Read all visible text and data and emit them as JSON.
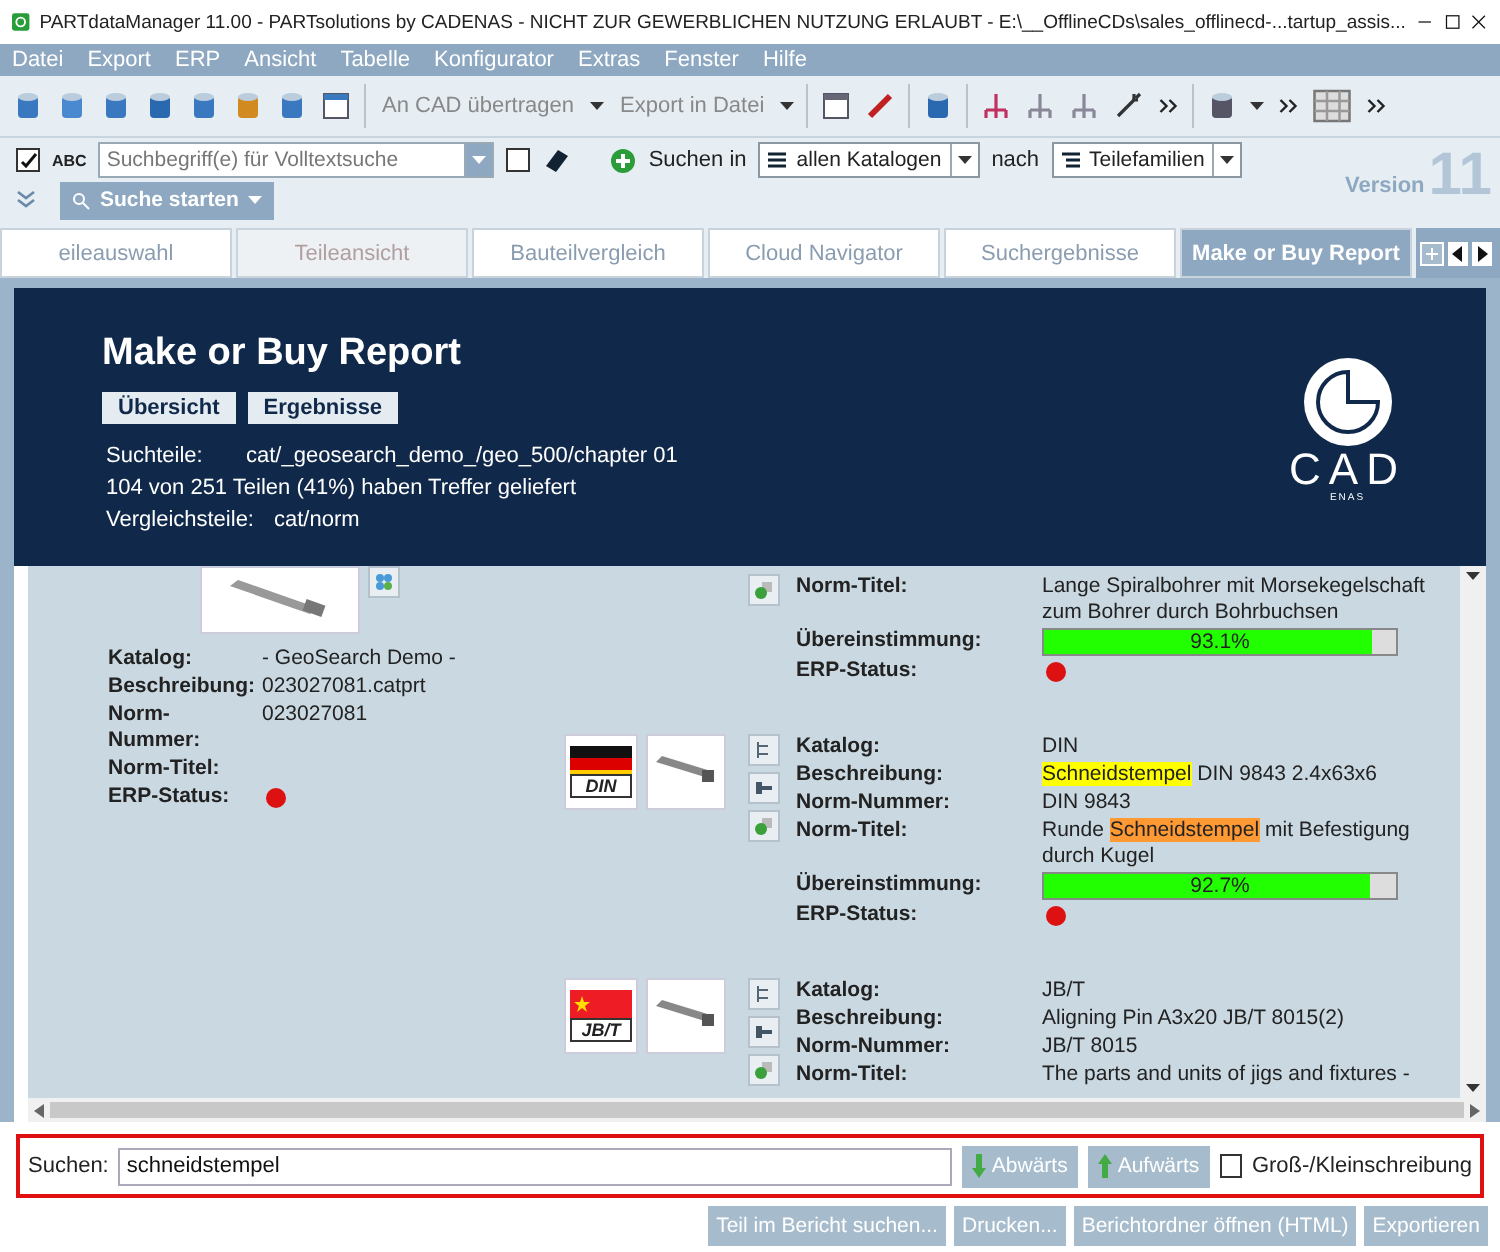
{
  "window": {
    "title": "PARTdataManager 11.00 - PARTsolutions by CADENAS - NICHT ZUR GEWERBLICHEN NUTZUNG ERLAUBT - E:\\__OfflineCDs\\sales_offlinecd-...tartup_assis..."
  },
  "menu": [
    "Datei",
    "Export",
    "ERP",
    "Ansicht",
    "Tabelle",
    "Konfigurator",
    "Extras",
    "Fenster",
    "Hilfe"
  ],
  "toolbar": {
    "transfer": "An CAD übertragen",
    "export": "Export in Datei"
  },
  "search": {
    "fulltext_checked": true,
    "abc": "ABC",
    "placeholder": "Suchbegriff(e) für Volltextsuche",
    "option_checked": false,
    "search_in": "Suchen in",
    "catalog": "allen Katalogen",
    "after": "nach",
    "mode": "Teilefamilien",
    "start": "Suche starten",
    "version_label": "Version",
    "version_number": "11"
  },
  "tabs": [
    {
      "label": "eileauswahl",
      "selected": false,
      "disabled": false
    },
    {
      "label": "Teileansicht",
      "selected": false,
      "disabled": true
    },
    {
      "label": "Bauteilvergleich",
      "selected": false,
      "disabled": false
    },
    {
      "label": "Cloud Navigator",
      "selected": false,
      "disabled": false
    },
    {
      "label": "Suchergebnisse",
      "selected": false,
      "disabled": false
    },
    {
      "label": "Make or Buy Report",
      "selected": true,
      "disabled": false
    }
  ],
  "report": {
    "title": "Make or Buy Report",
    "buttons": [
      "Übersicht",
      "Ergebnisse"
    ],
    "info": [
      {
        "label": "Suchteile:",
        "value": "cat/_geosearch_demo_/geo_500/chapter 01"
      },
      {
        "text": "104 von 251 Teilen (41%) haben Treffer geliefert"
      },
      {
        "label": "Vergleichsteile:",
        "value": "cat/norm"
      }
    ],
    "logo": {
      "text": "CAD",
      "subtext": "ENAS"
    }
  },
  "source": {
    "fields": [
      {
        "kind": "text",
        "label": "Katalog:",
        "value": "- GeoSearch Demo -"
      },
      {
        "kind": "text",
        "label": "Beschreibung:",
        "value": "023027081.catprt"
      },
      {
        "kind": "text",
        "label": "Norm-Nummer:",
        "value": "023027081"
      },
      {
        "kind": "text",
        "label": "Norm-Titel:"
      },
      {
        "kind": "status",
        "label": "ERP-Status:",
        "color": "#dd1111"
      }
    ]
  },
  "matches": [
    {
      "kind": "plain",
      "fields": [
        {
          "kind": "text",
          "label": "Norm-Titel:",
          "value": "Lange Spiralbohrer mit Morsekegelschaft zum Bohrer durch Bohrbuchsen"
        },
        {
          "kind": "meter",
          "label": "Übereinstimmung:",
          "level": 0.931,
          "reading": "93.1%"
        },
        {
          "kind": "status",
          "label": "ERP-Status:",
          "color": "#dd1111"
        }
      ]
    },
    {
      "kind": "de",
      "badge": "DIN",
      "fields": [
        {
          "kind": "text",
          "label": "Katalog:",
          "value": "DIN"
        },
        {
          "kind": "text",
          "label": "Beschreibung:",
          "parts": [
            {
              "text": "Schneidstempel",
              "color": "#ffff00"
            },
            {
              "text": " DIN 9843 2.4x63x6"
            }
          ]
        },
        {
          "kind": "text",
          "label": "Norm-Nummer:",
          "value": "DIN 9843"
        },
        {
          "kind": "text",
          "label": "Norm-Titel:",
          "parts": [
            {
              "text": "Runde "
            },
            {
              "text": "Schneidstempel",
              "color": "#ff9933"
            },
            {
              "text": " mit Befestigung durch Kugel"
            }
          ]
        },
        {
          "kind": "meter",
          "label": "Übereinstimmung:",
          "level": 0.927,
          "reading": "92.7%"
        },
        {
          "kind": "status",
          "label": "ERP-Status:",
          "color": "#dd1111"
        }
      ]
    },
    {
      "kind": "cn",
      "badge": "JB/T",
      "fields": [
        {
          "kind": "text",
          "label": "Katalog:",
          "value": "JB/T"
        },
        {
          "kind": "text",
          "label": "Beschreibung:",
          "value": "Aligning Pin A3x20 JB/T 8015(2)"
        },
        {
          "kind": "text",
          "label": "Norm-Nummer:",
          "value": "JB/T 8015"
        },
        {
          "kind": "text",
          "label": "Norm-Titel:",
          "value": "The parts and units of jigs and fixtures -"
        }
      ]
    }
  ],
  "find": {
    "label": "Suchen:",
    "value": "schneidstempel",
    "down": "Abwärts",
    "up": "Aufwärts",
    "case_label": "Groß-/Kleinschreibung",
    "case_checked": false
  },
  "actions": [
    "Teil im Bericht suchen...",
    "Drucken...",
    "Berichtordner öffnen (HTML)",
    "Exportieren"
  ]
}
